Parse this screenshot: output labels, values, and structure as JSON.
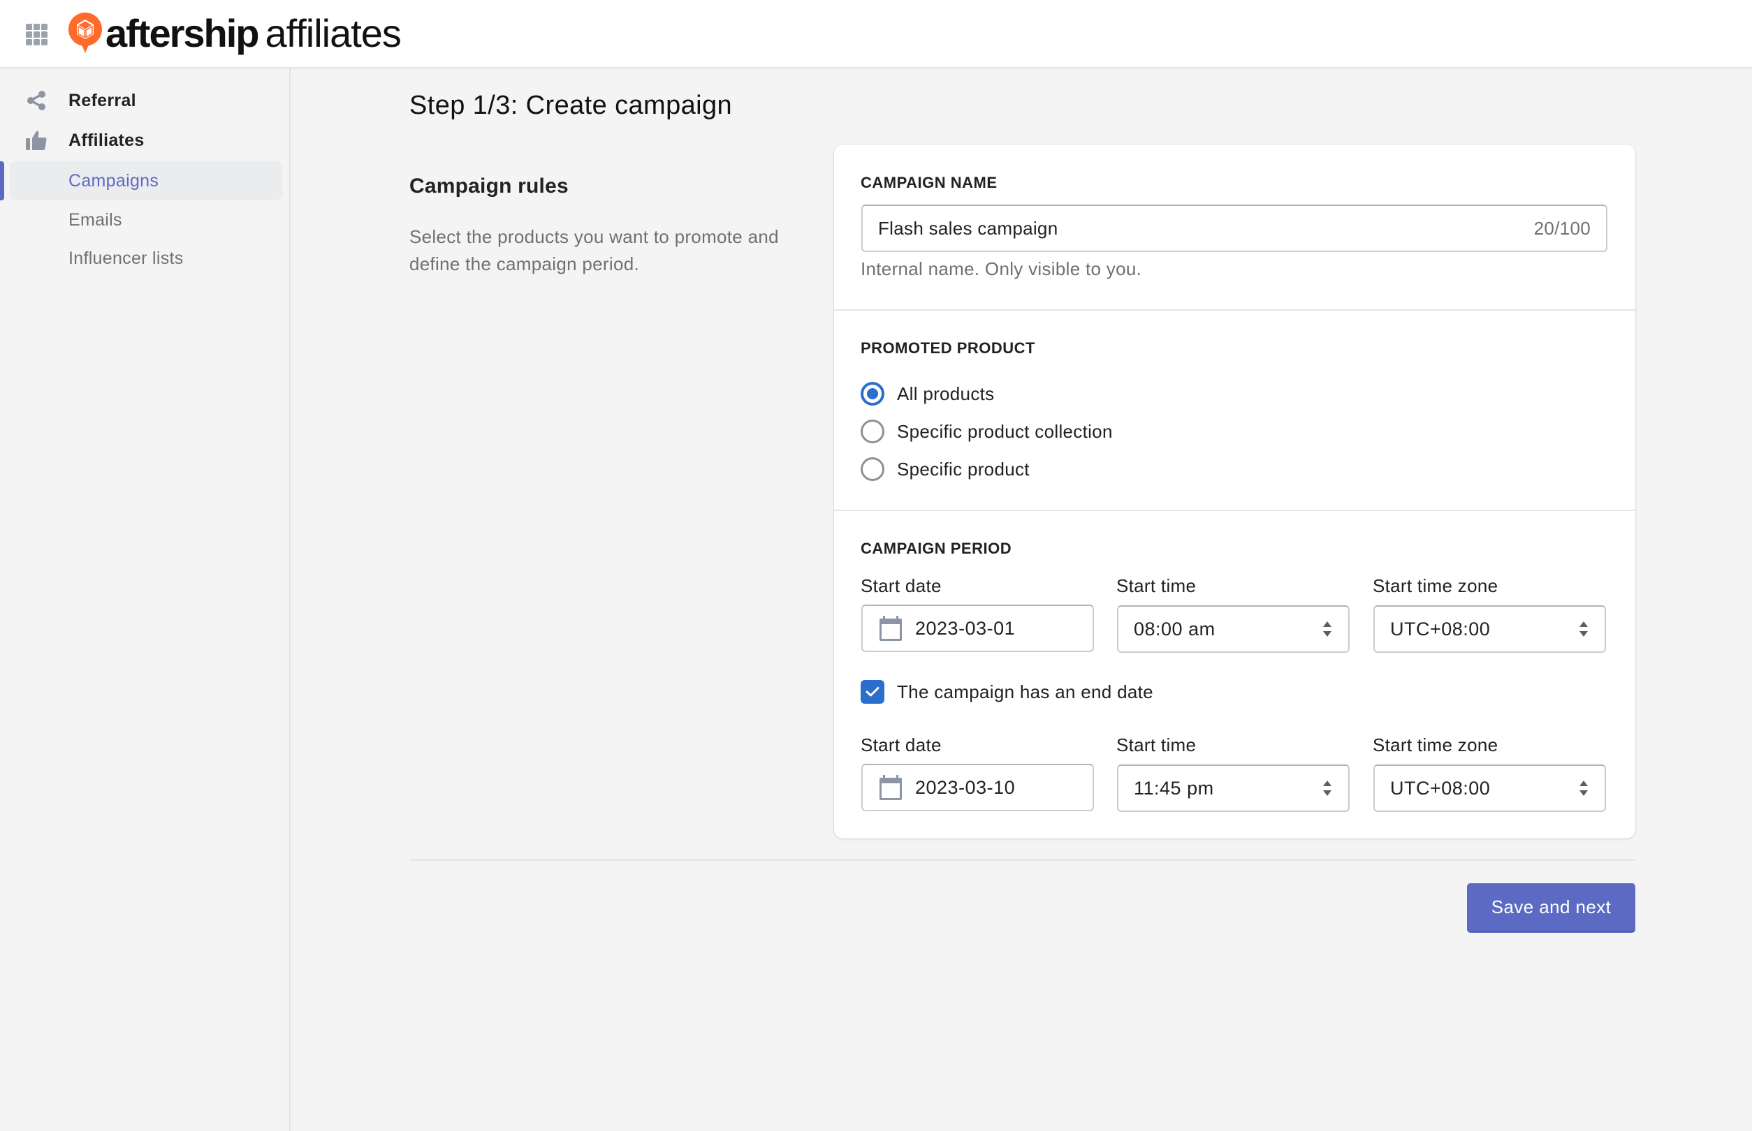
{
  "header": {
    "apps_icon": "grid-apps-icon",
    "brand": "aftership",
    "product": "affiliates",
    "logo_color": "#ff6b2b"
  },
  "sidebar": {
    "items": [
      {
        "label": "Referral",
        "icon": "share-icon",
        "level": "main"
      },
      {
        "label": "Affiliates",
        "icon": "thumbs-up-icon",
        "level": "main"
      },
      {
        "label": "Campaigns",
        "level": "sub",
        "active": true
      },
      {
        "label": "Emails",
        "level": "sub"
      },
      {
        "label": "Influencer lists",
        "level": "sub"
      }
    ],
    "accent_color": "#5c6ac4"
  },
  "main": {
    "title": "Step 1/3: Create campaign",
    "section": {
      "title": "Campaign rules",
      "description": "Select the products you want to promote and define the campaign period."
    },
    "campaign_name": {
      "label": "CAMPAIGN NAME",
      "value": "Flash sales campaign",
      "counter": "20/100",
      "help": "Internal name. Only visible to you."
    },
    "promoted_product": {
      "label": "PROMOTED PRODUCT",
      "options": [
        {
          "label": "All products",
          "checked": true
        },
        {
          "label": "Specific product collection",
          "checked": false
        },
        {
          "label": "Specific product",
          "checked": false
        }
      ]
    },
    "campaign_period": {
      "label": "CAMPAIGN PERIOD",
      "start": {
        "date_label": "Start date",
        "date_value": "2023-03-01",
        "time_label": "Start time",
        "time_value": "08:00 am",
        "zone_label": "Start time zone",
        "zone_value": "UTC+08:00"
      },
      "end_date_checkbox": {
        "label": "The campaign has an end date",
        "checked": true
      },
      "end": {
        "date_label": "Start date",
        "date_value": "2023-03-10",
        "time_label": "Start time",
        "time_value": "11:45 pm",
        "zone_label": "Start time zone",
        "zone_value": "UTC+08:00"
      }
    },
    "actions": {
      "save_next_label": "Save and next",
      "primary_color": "#5c6ac4"
    }
  }
}
